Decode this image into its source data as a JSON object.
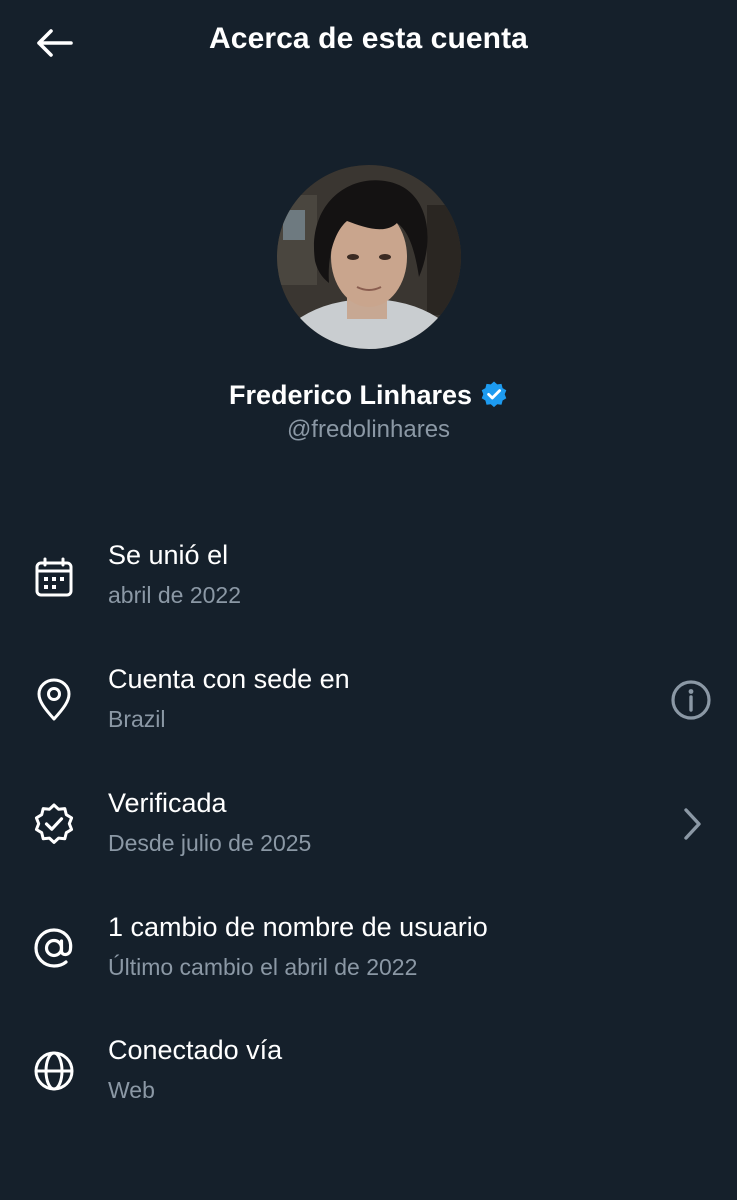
{
  "header": {
    "title": "Acerca de esta cuenta",
    "back_icon": "arrow-left-icon"
  },
  "profile": {
    "name": "Frederico Linhares",
    "handle": "@fredolinhares",
    "verified_icon": "verified-badge-icon",
    "verified_color": "#1d9bf0"
  },
  "details": [
    {
      "label": "Se unió el",
      "value": "abril de 2022",
      "icon": "calendar-icon"
    },
    {
      "label": "Cuenta con sede en",
      "value": "Brazil",
      "icon": "location-pin-icon",
      "action_icon": "info-icon"
    },
    {
      "label": "Verificada",
      "value": "Desde julio de 2025",
      "icon": "verified-check-icon",
      "action_icon": "chevron-right-icon"
    },
    {
      "label": "1 cambio de nombre de usuario",
      "value": "Último cambio el abril de 2022",
      "icon": "at-sign-icon"
    },
    {
      "label": "Conectado vía",
      "value": "Web",
      "icon": "globe-icon"
    }
  ],
  "colors": {
    "background": "#15202b",
    "primary_text": "#ffffff",
    "secondary_text": "#8b98a5",
    "accent": "#1d9bf0"
  }
}
